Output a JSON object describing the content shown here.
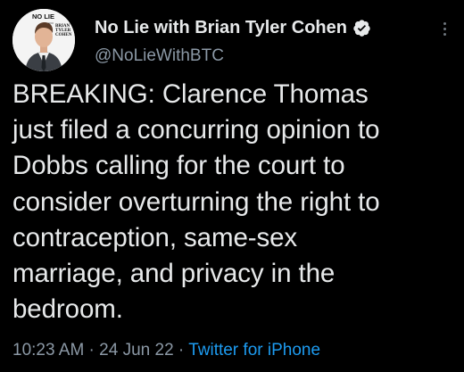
{
  "author": {
    "display_name": "No Lie with Brian Tyler Cohen",
    "handle": "@NoLieWithBTC",
    "avatar_text": {
      "line1": "NO LIE",
      "line2": "BRIAN",
      "line3": "TYLER",
      "line4": "COHEN"
    }
  },
  "tweet": {
    "lines": [
      "BREAKING: Clarence Thomas",
      "just filed a concurring opinion to",
      "Dobbs calling for the court to",
      "consider overturning the right to",
      "contraception, same-sex",
      "marriage, and privacy in the",
      "bedroom."
    ]
  },
  "meta": {
    "time": "10:23 AM",
    "separator1": " · ",
    "date": "24 Jun 22",
    "separator2": " · ",
    "source": "Twitter for iPhone"
  },
  "icons": {
    "verified": "verified-badge-icon",
    "more": "more-options-icon"
  },
  "colors": {
    "background": "#000000",
    "text": "#e7e9ea",
    "secondary": "#8b98a5",
    "link": "#1d9bf0"
  }
}
